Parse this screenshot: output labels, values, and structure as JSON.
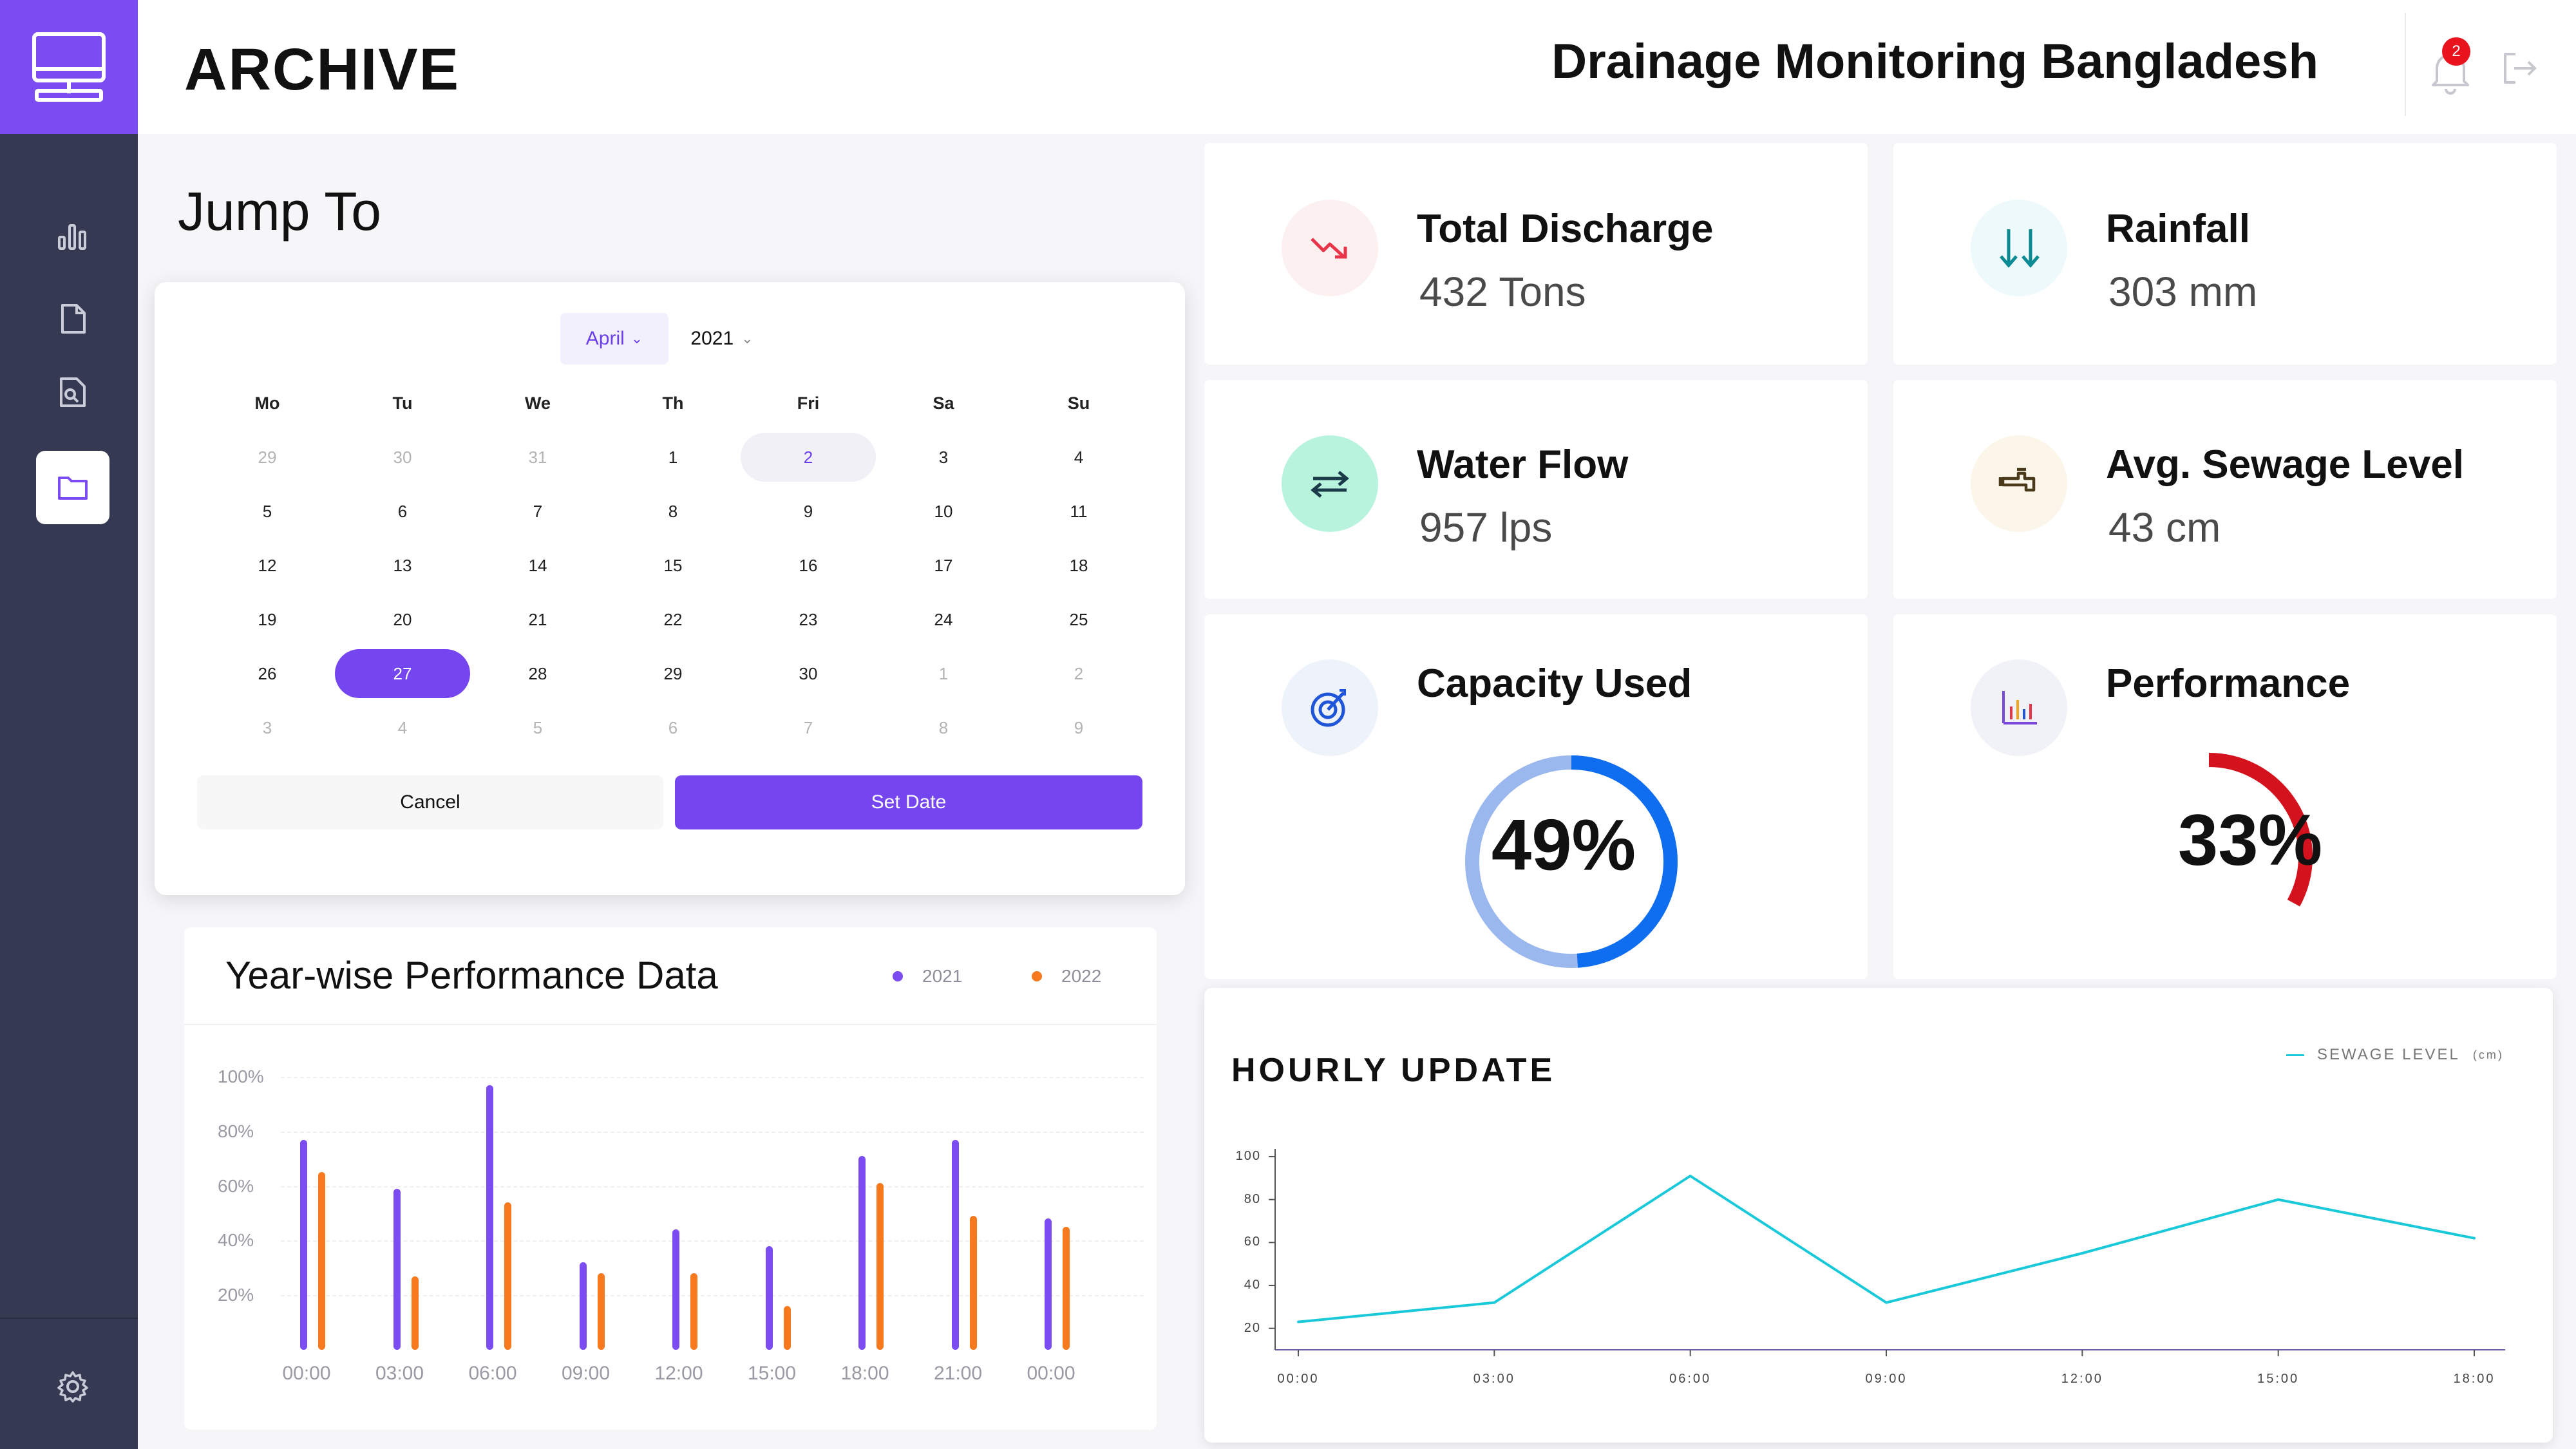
{
  "header": {
    "page_title": "ARCHIVE",
    "site_title": "Drainage Monitoring Bangladesh",
    "notifications_count": "2"
  },
  "sidebar": {
    "items": [
      {
        "icon": "bar-chart-icon",
        "active": false
      },
      {
        "icon": "document-icon",
        "active": false
      },
      {
        "icon": "report-icon",
        "active": false
      },
      {
        "icon": "folder-icon",
        "active": true
      }
    ],
    "settings_icon": "gear-icon"
  },
  "jump_to": {
    "title": "Jump To",
    "month": "April",
    "year": "2021",
    "weekdays": [
      "Mo",
      "Tu",
      "We",
      "Th",
      "Fri",
      "Sa",
      "Su"
    ],
    "weeks": [
      [
        {
          "d": "29",
          "muted": true
        },
        {
          "d": "30",
          "muted": true
        },
        {
          "d": "31",
          "muted": true
        },
        {
          "d": "1"
        },
        {
          "d": "2",
          "today": true
        },
        {
          "d": "3"
        },
        {
          "d": "4"
        }
      ],
      [
        {
          "d": "5"
        },
        {
          "d": "6"
        },
        {
          "d": "7"
        },
        {
          "d": "8"
        },
        {
          "d": "9"
        },
        {
          "d": "10"
        },
        {
          "d": "11"
        }
      ],
      [
        {
          "d": "12"
        },
        {
          "d": "13"
        },
        {
          "d": "14"
        },
        {
          "d": "15"
        },
        {
          "d": "16"
        },
        {
          "d": "17"
        },
        {
          "d": "18"
        }
      ],
      [
        {
          "d": "19"
        },
        {
          "d": "20"
        },
        {
          "d": "21"
        },
        {
          "d": "22"
        },
        {
          "d": "23"
        },
        {
          "d": "24"
        },
        {
          "d": "25"
        }
      ],
      [
        {
          "d": "26"
        },
        {
          "d": "27",
          "selected": true
        },
        {
          "d": "28"
        },
        {
          "d": "29"
        },
        {
          "d": "30"
        },
        {
          "d": "1",
          "muted": true
        },
        {
          "d": "2",
          "muted": true
        }
      ],
      [
        {
          "d": "3",
          "muted": true
        },
        {
          "d": "4",
          "muted": true
        },
        {
          "d": "5",
          "muted": true
        },
        {
          "d": "6",
          "muted": true
        },
        {
          "d": "7",
          "muted": true
        },
        {
          "d": "8",
          "muted": true
        },
        {
          "d": "9",
          "muted": true
        }
      ]
    ],
    "cancel_label": "Cancel",
    "set_date_label": "Set Date"
  },
  "stats": {
    "total_discharge": {
      "title": "Total Discharge",
      "value": "432 Tons",
      "icon": "trend-down-icon"
    },
    "rainfall": {
      "title": "Rainfall",
      "value": "303 mm",
      "icon": "rain-arrows-icon"
    },
    "water_flow": {
      "title": "Water Flow",
      "value": "957 lps",
      "icon": "flow-arrows-icon"
    },
    "sewage_level": {
      "title": "Avg. Sewage Level",
      "value": "43 cm",
      "icon": "faucet-icon"
    },
    "capacity": {
      "title": "Capacity Used",
      "value_label": "49%",
      "value": 49,
      "icon": "target-icon"
    },
    "performance": {
      "title": "Performance",
      "value_label": "33%",
      "value": 33,
      "icon": "performance-chart-icon"
    }
  },
  "colors": {
    "accent": "#7546ef",
    "series_2021": "#7b4cf2",
    "series_2022": "#f7791e",
    "capacity_ring": "#0f6ef0",
    "capacity_track": "#9ab8ee",
    "performance_arc": "#d4121e",
    "line": "#19c9d9"
  },
  "chart_data": [
    {
      "type": "bar",
      "title": "Year-wise Performance Data",
      "categories": [
        "00:00",
        "03:00",
        "06:00",
        "09:00",
        "12:00",
        "15:00",
        "18:00",
        "21:00",
        "00:00"
      ],
      "series": [
        {
          "name": "2021",
          "values": [
            77,
            59,
            97,
            32,
            44,
            38,
            71,
            77,
            48
          ]
        },
        {
          "name": "2022",
          "values": [
            65,
            27,
            54,
            28,
            28,
            16,
            61,
            49,
            45
          ]
        }
      ],
      "y_ticks": [
        "100%",
        "80%",
        "60%",
        "40%",
        "20%"
      ],
      "ylim": [
        0,
        100
      ],
      "legend": "top-right"
    },
    {
      "type": "line",
      "title": "HOURLY UPDATE",
      "legend_label": "SEWAGE LEVEL",
      "legend_unit": "(cm)",
      "x": [
        "00:00",
        "03:00",
        "06:00",
        "09:00",
        "12:00",
        "15:00",
        "18:00"
      ],
      "series": [
        {
          "name": "SEWAGE LEVEL",
          "values": [
            23,
            32,
            91,
            32,
            55,
            80,
            62
          ]
        }
      ],
      "y_ticks": [
        "100",
        "80",
        "60",
        "40",
        "20"
      ],
      "ylim": [
        10,
        100
      ],
      "legend": "top-right"
    }
  ]
}
